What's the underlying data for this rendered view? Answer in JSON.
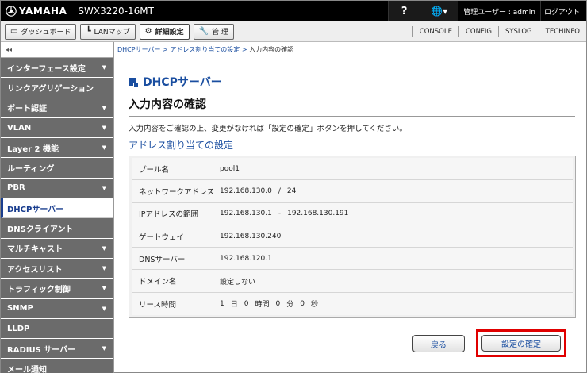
{
  "header": {
    "brand": "YAMAHA",
    "model": "SWX3220-16MT",
    "help_label": "?",
    "lang_label": "🌐▾",
    "user_label": "管理ユーザー : admin",
    "logout_label": "ログアウト"
  },
  "toolbar": {
    "buttons": [
      {
        "label": "ダッシュボード",
        "icon": "dashboard-icon"
      },
      {
        "label": "LANマップ",
        "icon": "lan-map-icon"
      },
      {
        "label": "詳細設定",
        "icon": "gear-icon"
      },
      {
        "label": "管 理",
        "icon": "wrench-icon"
      }
    ],
    "links": [
      "CONSOLE",
      "CONFIG",
      "SYSLOG",
      "TECHINFO"
    ]
  },
  "sidebar": {
    "collapse_label": "◂◂",
    "items": [
      {
        "label": "インターフェース設定",
        "arrow": true
      },
      {
        "label": "リンクアグリゲーション",
        "arrow": false
      },
      {
        "label": "ポート認証",
        "arrow": true
      },
      {
        "label": "VLAN",
        "arrow": true
      },
      {
        "label": "Layer 2 機能",
        "arrow": true
      },
      {
        "label": "ルーティング",
        "arrow": false
      },
      {
        "label": "PBR",
        "arrow": true
      },
      {
        "label": "DHCPサーバー",
        "arrow": false
      },
      {
        "label": "DNSクライアント",
        "arrow": false
      },
      {
        "label": "マルチキャスト",
        "arrow": true
      },
      {
        "label": "アクセスリスト",
        "arrow": true
      },
      {
        "label": "トラフィック制御",
        "arrow": true
      },
      {
        "label": "SNMP",
        "arrow": true
      },
      {
        "label": "LLDP",
        "arrow": false
      },
      {
        "label": "RADIUS サーバー",
        "arrow": true
      },
      {
        "label": "メール通知",
        "arrow": false
      }
    ],
    "active_index": 7
  },
  "main": {
    "breadcrumb": {
      "items": [
        "DHCPサーバー",
        "アドレス割り当ての設定"
      ],
      "separator": ">",
      "current": "入力内容の確認"
    },
    "page_title": "DHCPサーバー",
    "sub_title": "入力内容の確認",
    "instruction": "入力内容をご確認の上、変更がなければ「設定の確定」ボタンを押してください。",
    "section_title": "アドレス割り当ての設定",
    "fields": {
      "pool_name": {
        "label": "プール名",
        "value": "pool1"
      },
      "network_address": {
        "label": "ネットワークアドレス",
        "address": "192.168.130.0",
        "sep": "/",
        "prefix": "24"
      },
      "ip_range": {
        "label": "IPアドレスの範囲",
        "start": "192.168.130.1",
        "sep": "-",
        "end": "192.168.130.191"
      },
      "gateway": {
        "label": "ゲートウェイ",
        "value": "192.168.130.240"
      },
      "dns_server": {
        "label": "DNSサーバー",
        "value": "192.168.120.1"
      },
      "domain_name": {
        "label": "ドメイン名",
        "value": "設定しない"
      },
      "lease_time": {
        "label": "リース時間",
        "days": "1",
        "days_unit": "日",
        "hours": "0",
        "hours_unit": "時間",
        "minutes": "0",
        "minutes_unit": "分",
        "seconds": "0",
        "seconds_unit": "秒"
      }
    },
    "back_label": "戻る",
    "confirm_label": "設定の確定"
  },
  "colors": {
    "topbar": "#000000",
    "sidebar_item": "#6b6b6b",
    "accent": "#1a4ea0",
    "highlight": "#e00000"
  }
}
